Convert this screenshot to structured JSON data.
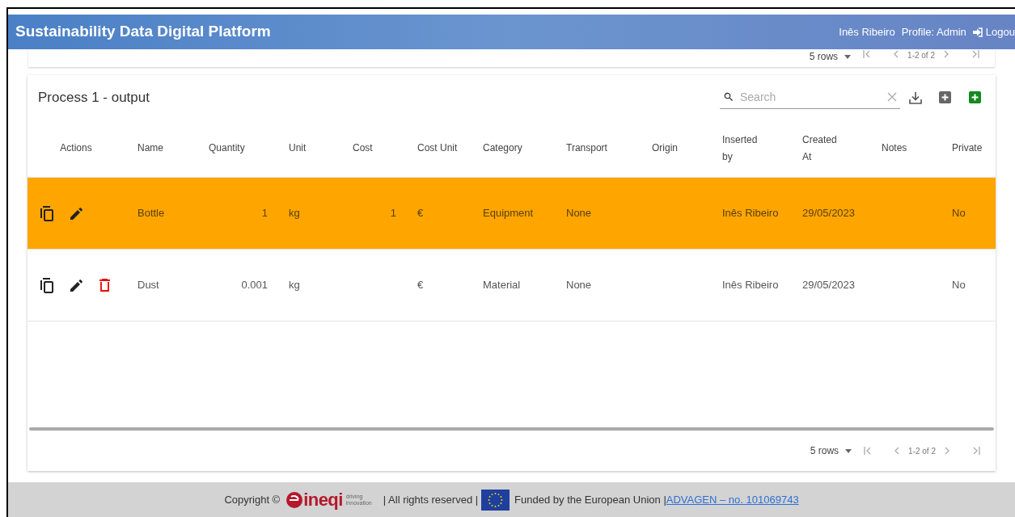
{
  "header": {
    "title": "Sustainability Data Digital Platform",
    "user": "Inês Ribeiro",
    "profile": "Profile: Admin",
    "logout": "Logou"
  },
  "top_pagination": {
    "rows": "5 rows",
    "range": "1-2 of 2"
  },
  "table_card": {
    "title": "Process 1 - output",
    "search": {
      "placeholder": "Search"
    },
    "columns": [
      {
        "label": "Actions"
      },
      {
        "label": "Name"
      },
      {
        "label": "Quantity"
      },
      {
        "label": "Unit"
      },
      {
        "label": "Cost"
      },
      {
        "label": "Cost Unit"
      },
      {
        "label": "Category"
      },
      {
        "label": "Transport"
      },
      {
        "label": "Origin"
      },
      {
        "label": "Inserted by"
      },
      {
        "label": "Created At"
      },
      {
        "label": "Notes"
      },
      {
        "label": "Private"
      }
    ],
    "rows": [
      {
        "selected": true,
        "deletable": false,
        "cells": [
          "",
          "Bottle",
          "1",
          "kg",
          "1",
          "€",
          "Equipment",
          "None",
          "",
          "Inês Ribeiro",
          "29/05/2023",
          "",
          "No"
        ]
      },
      {
        "selected": false,
        "deletable": true,
        "cells": [
          "",
          "Dust",
          "0.001",
          "kg",
          "",
          "€",
          "Material",
          "None",
          "",
          "Inês Ribeiro",
          "29/05/2023",
          "",
          "No"
        ]
      }
    ],
    "pagination": {
      "rows": "5 rows",
      "range": "1-2 of 2"
    }
  },
  "footer": {
    "copyright": "Copyright ©",
    "logo_name": "ineqi",
    "logo_tagline": "driving innovation",
    "rights": "| All rights reserved |",
    "funded": "Funded by the European Union |",
    "link": "ADVAGEN – no. 101069743"
  }
}
